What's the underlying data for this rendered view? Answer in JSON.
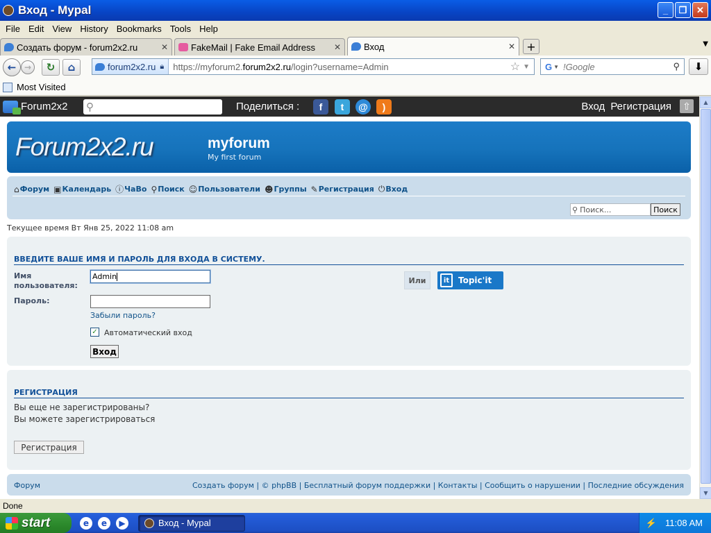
{
  "window": {
    "title": "Вход - Mypal"
  },
  "menu": [
    "File",
    "Edit",
    "View",
    "History",
    "Bookmarks",
    "Tools",
    "Help"
  ],
  "tabs": [
    {
      "label": "Создать форум - forum2x2.ru",
      "active": false
    },
    {
      "label": "FakeMail | Fake Email Address",
      "active": false
    },
    {
      "label": "Вход",
      "active": true
    }
  ],
  "nav": {
    "site_identity": "forum2x2.ru",
    "url_prefix": "https://myforum2.",
    "url_domain": "forum2x2.ru",
    "url_suffix": "/login?username=Admin",
    "search_engine_placeholder": "!Google"
  },
  "bookmarks": {
    "most_visited": "Most Visited"
  },
  "toolbar": {
    "logo_text": "Forum2x2",
    "share_label": "Поделиться :",
    "login_link": "Вход",
    "register_link": "Регистрация"
  },
  "header": {
    "logo": "Forum2x2.ru",
    "forum_name": "myforum",
    "forum_desc": "My first forum"
  },
  "forum_nav": {
    "links": [
      {
        "icon": "home-icon",
        "glyph": "⌂",
        "label": "Форум"
      },
      {
        "icon": "calendar-icon",
        "glyph": "▣",
        "label": "Календарь"
      },
      {
        "icon": "faq-icon",
        "glyph": "?",
        "label": "ЧаВо"
      },
      {
        "icon": "search-icon",
        "glyph": "⚲",
        "label": "Поиск"
      },
      {
        "icon": "users-icon",
        "glyph": "☺",
        "label": "Пользователи"
      },
      {
        "icon": "groups-icon",
        "glyph": "☻",
        "label": "Группы"
      },
      {
        "icon": "register-icon",
        "glyph": "✎",
        "label": "Регистрация"
      },
      {
        "icon": "login-icon",
        "glyph": "⏻",
        "label": "Вход"
      }
    ],
    "search_placeholder": "Поиск...",
    "search_button": "Поиск"
  },
  "time_text": "Текущее время Вт Янв 25, 2022 11:08 am",
  "login": {
    "heading": "Введите ваше имя и пароль для входа в систему.",
    "username_label": "Имя пользователя:",
    "username_value": "Admin",
    "password_label": "Пароль:",
    "password_value": "",
    "forgot_link": "Забыли пароль?",
    "autologin_label": "Автоматический вход",
    "autologin_checked": true,
    "submit": "Вход",
    "or_label": "Или",
    "topicit_label": "Topic'it"
  },
  "register": {
    "heading": "Регистрация",
    "line1": "Вы еще не зарегистрированы?",
    "line2": "Вы можете зарегистрироваться",
    "button": "Регистрация"
  },
  "footer": {
    "left": "Форум",
    "links": [
      "Создать форум",
      "©",
      "phpBB",
      "Бесплатный форум поддержки",
      "Контакты",
      "Сообщить о нарушении",
      "Последние обсуждения"
    ]
  },
  "status": "Done",
  "taskbar": {
    "start": "start",
    "task": "Вход - Mypal",
    "clock": "11:08 AM"
  },
  "colors": {
    "accent": "#115098",
    "header_blue": "#1673bb",
    "nav_bg": "#cadceb",
    "panel_bg": "#ecf1f3"
  }
}
